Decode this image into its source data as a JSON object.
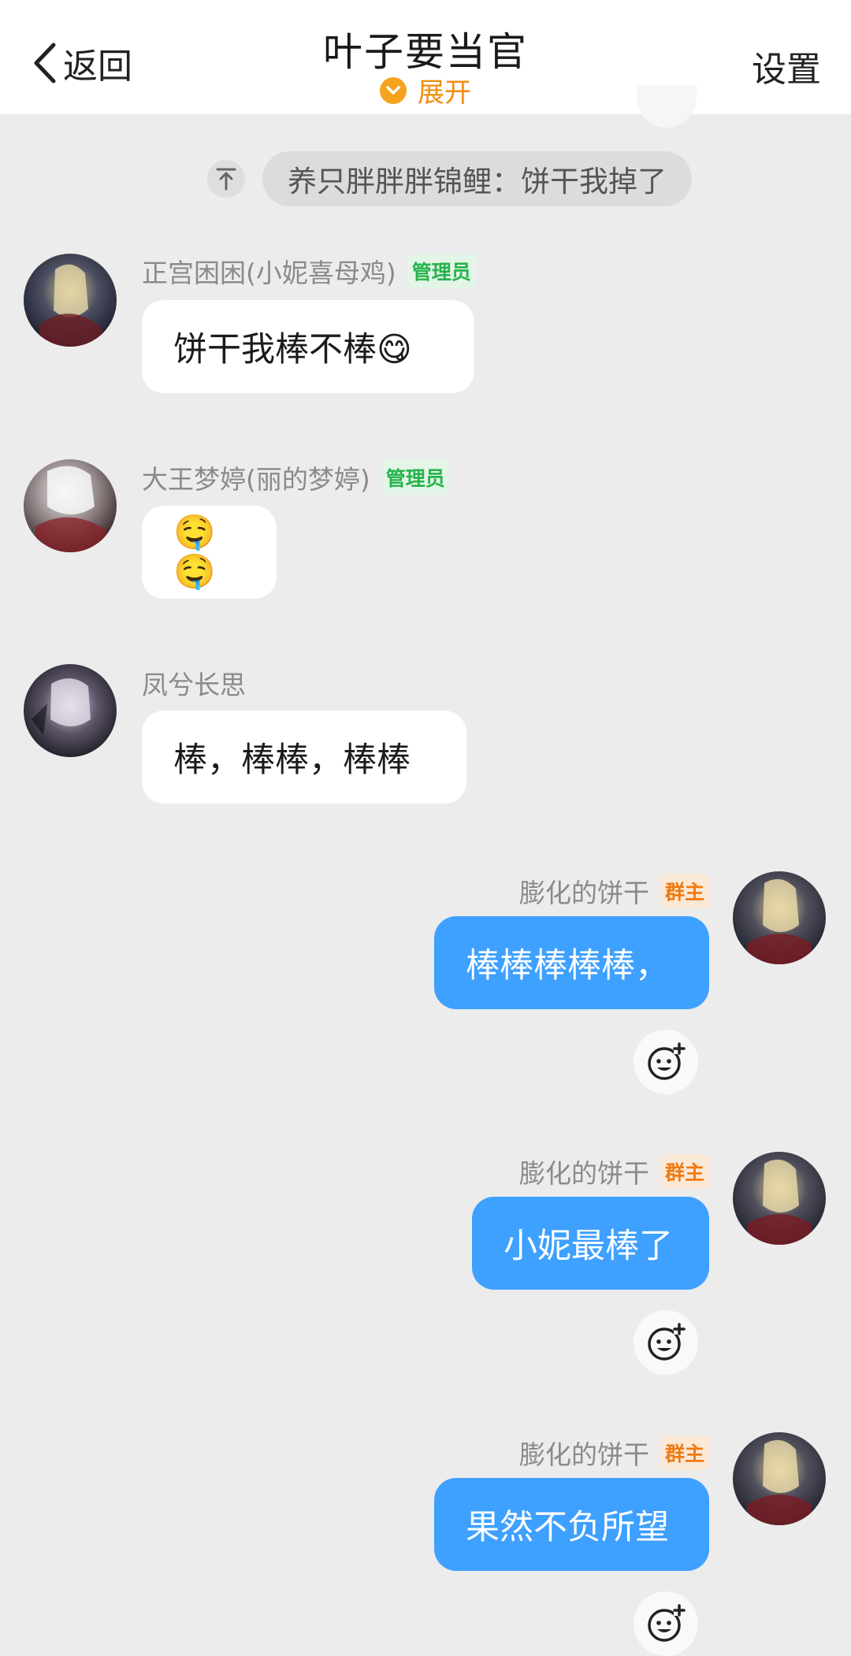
{
  "header": {
    "back_label": "返回",
    "title": "叶子要当官",
    "expand_label": "展开",
    "settings_label": "设置"
  },
  "pinned": {
    "text": "养只胖胖胖锦鲤：饼干我掉了"
  },
  "messages": [
    {
      "sender": "正宫困困(小妮喜母鸡)",
      "badge": "管理员",
      "text": "饼干我棒不棒😋",
      "side": "left"
    },
    {
      "sender": "大王梦婷(丽的梦婷)",
      "badge": "管理员",
      "text": "🤤🤤",
      "side": "left"
    },
    {
      "sender": "凤兮长思",
      "badge": "",
      "text": "棒，棒棒，棒棒",
      "side": "left"
    },
    {
      "sender": "膨化的饼干",
      "badge": "群主",
      "text": "棒棒棒棒棒，",
      "side": "right"
    },
    {
      "sender": "膨化的饼干",
      "badge": "群主",
      "text": "小妮最棒了",
      "side": "right"
    },
    {
      "sender": "膨化的饼干",
      "badge": "群主",
      "text": "果然不负所望",
      "side": "right"
    }
  ],
  "colors": {
    "accent_orange": "#f28c0f",
    "bubble_out": "#3ea0ff",
    "admin_badge": "#26b34b",
    "owner_badge": "#f07a12"
  },
  "icons": {
    "back": "chevron-left-icon",
    "expand": "chevron-down-circle-icon",
    "pin": "pin-top-icon",
    "react": "add-emoji-icon"
  }
}
